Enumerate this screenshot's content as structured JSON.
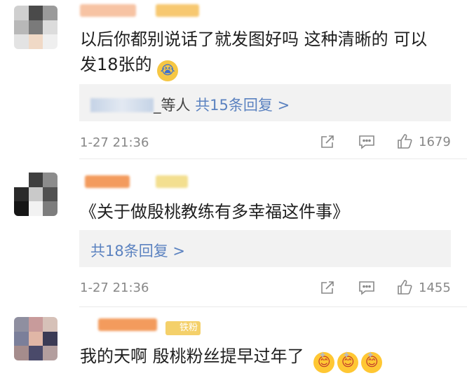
{
  "comments": [
    {
      "text": "以后你都别说话了就发图好吗 这种清晰的 可以",
      "text2": "发18张的",
      "emoji": "cry-face-emoji",
      "replies": {
        "suffix": "_等人 ",
        "link": "共15条回复 >"
      },
      "time": "1-27 21:36",
      "likes": "1679",
      "avatar_colors": [
        "#cfcfcf",
        "#4a4a4a",
        "#9a9a9a",
        "#b8b8b8",
        "#7a7a7a",
        "#dcdcdc",
        "#e3e3e3",
        "#f0d9c6",
        "#efefef"
      ]
    },
    {
      "text": "《关于做殷桃教练有多幸福这件事》",
      "replies": {
        "link": "共18条回复 >"
      },
      "time": "1-27 21:36",
      "likes": "1455",
      "avatar_colors": [
        "#ffffff",
        "#3f3f3f",
        "#8c8c8c",
        "#2a2a2a",
        "#c9c9c9",
        "#515151",
        "#161616",
        "#f2f2f2",
        "#7d7d7d"
      ]
    },
    {
      "text": "我的天啊 殷桃粉丝提早过年了",
      "badge": "铁粉",
      "avatar_colors": [
        "#8f8fa0",
        "#c89b9b",
        "#d6c1b8",
        "#7b7f9a",
        "#e0b6a6",
        "#3b3b55",
        "#a58c8c",
        "#4a4a6a",
        "#b39e9e"
      ]
    }
  ],
  "colors": {
    "link": "#5b82c0",
    "meta": "#888888",
    "reply_bg": "#f2f2f2"
  }
}
